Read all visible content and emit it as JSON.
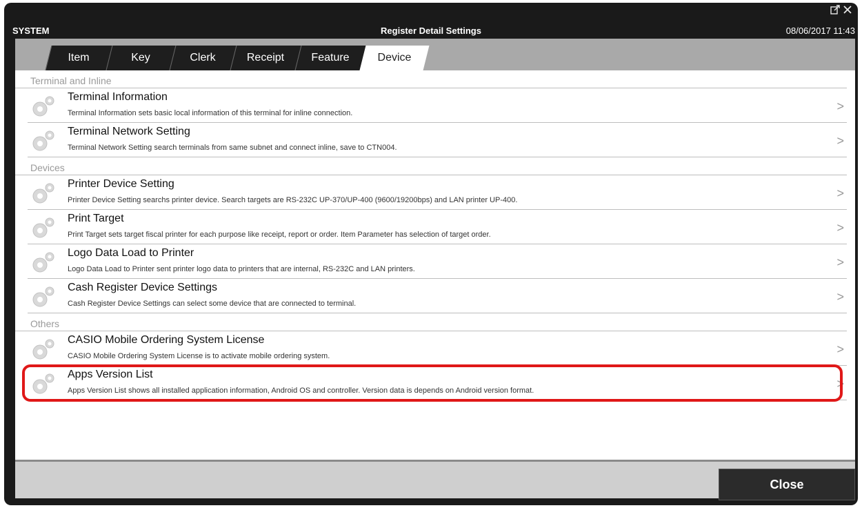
{
  "window": {
    "title": "Register Detail Settings",
    "system_label": "SYSTEM",
    "datetime": "08/06/2017 11:43",
    "popout_icon": "popout-icon",
    "close_icon": "close-icon"
  },
  "tabs": [
    {
      "label": "Item",
      "active": false
    },
    {
      "label": "Key",
      "active": false
    },
    {
      "label": "Clerk",
      "active": false
    },
    {
      "label": "Receipt",
      "active": false
    },
    {
      "label": "Feature",
      "active": false
    },
    {
      "label": "Device",
      "active": true
    }
  ],
  "sections": [
    {
      "title": "Terminal and Inline",
      "items": [
        {
          "title": "Terminal Information",
          "desc": "Terminal Information sets basic local information of this terminal for inline connection."
        },
        {
          "title": "Terminal Network Setting",
          "desc": "Terminal Network Setting search terminals from same subnet and connect inline, save to CTN004."
        }
      ]
    },
    {
      "title": "Devices",
      "items": [
        {
          "title": "Printer Device Setting",
          "desc": "Printer Device Setting searchs printer device. Search targets are RS-232C UP-370/UP-400 (9600/19200bps) and LAN printer UP-400."
        },
        {
          "title": "Print Target",
          "desc": "Print Target sets target fiscal printer for each purpose like receipt, report or order. Item Parameter has selection of target order."
        },
        {
          "title": "Logo Data Load to Printer",
          "desc": "Logo Data Load to Printer sent printer logo data to printers that are internal, RS-232C and LAN printers."
        },
        {
          "title": "Cash Register Device Settings",
          "desc": "Cash Register Device Settings can select some device that are connected to terminal."
        }
      ]
    },
    {
      "title": "Others",
      "items": [
        {
          "title": "CASIO Mobile Ordering System License",
          "desc": "CASIO Mobile Ordering System License is to activate mobile ordering system."
        },
        {
          "title": "Apps Version List",
          "desc": "Apps Version List shows all installed application information, Android OS and controller. Version data is depends on Android version format."
        }
      ]
    }
  ],
  "chevron": ">",
  "footer": {
    "close_label": "Close"
  },
  "colors": {
    "highlight": "#e01818",
    "active_tab": "#ffffff",
    "tab_bg": "#1e1e1e"
  }
}
